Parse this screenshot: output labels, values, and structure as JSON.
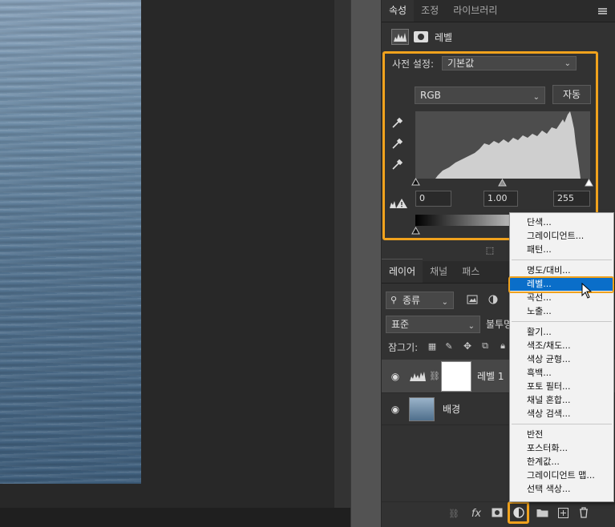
{
  "properties_panel": {
    "tabs": [
      {
        "label": "속성"
      },
      {
        "label": "조정"
      },
      {
        "label": "라이브러리"
      }
    ],
    "adjustment_name": "레벨",
    "preset_label": "사전 설정:",
    "preset_value": "기본값",
    "channel_value": "RGB",
    "auto_label": "자동",
    "input_black": "0",
    "input_gamma": "1.00",
    "input_white": "255"
  },
  "layers_panel": {
    "tabs": [
      {
        "label": "레이어"
      },
      {
        "label": "채널"
      },
      {
        "label": "패스"
      }
    ],
    "filter_label": "종류",
    "blend_mode": "표준",
    "opacity_label": "불투명",
    "lock_label": "잠그기:",
    "layers": [
      {
        "name": "레벨 1"
      },
      {
        "name": "배경"
      }
    ]
  },
  "adjustment_menu": {
    "items": [
      {
        "label": "단색..."
      },
      {
        "label": "그레이디언트..."
      },
      {
        "label": "패턴..."
      },
      {
        "label": "명도/대비..."
      },
      {
        "label": "레벨..."
      },
      {
        "label": "곡선..."
      },
      {
        "label": "노출..."
      },
      {
        "label": "활기..."
      },
      {
        "label": "색조/채도..."
      },
      {
        "label": "색상 균형..."
      },
      {
        "label": "흑백..."
      },
      {
        "label": "포토 필터..."
      },
      {
        "label": "채널 혼합..."
      },
      {
        "label": "색상 검색..."
      },
      {
        "label": "반전"
      },
      {
        "label": "포스터화..."
      },
      {
        "label": "한계값..."
      },
      {
        "label": "그레이디언트 맵..."
      },
      {
        "label": "선택 색상..."
      }
    ],
    "selected": "레벨..."
  },
  "colors": {
    "highlight": "#f0a21d",
    "selection": "#0a6ec9"
  },
  "histogram": {
    "channel": "RGB",
    "input_levels": [
      0,
      1.0,
      255
    ]
  }
}
